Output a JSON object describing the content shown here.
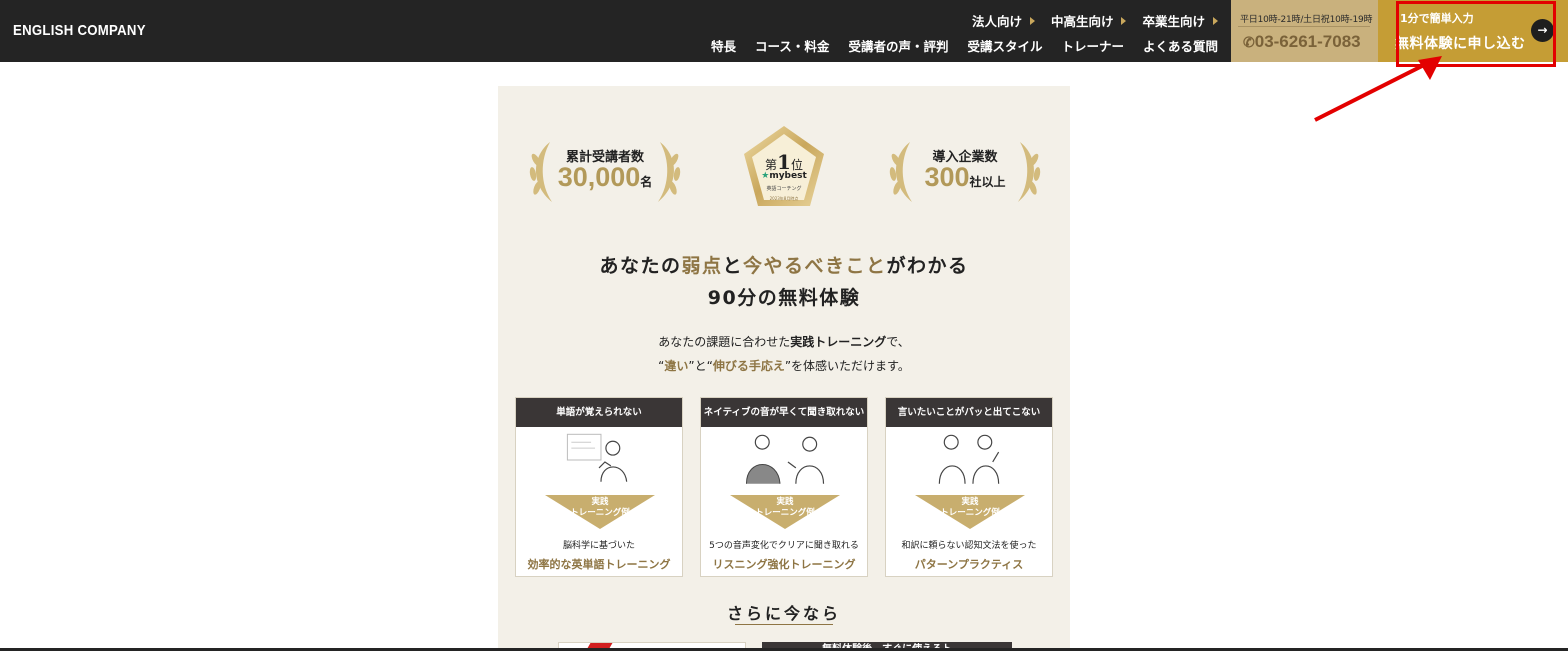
{
  "header": {
    "logo": "ENGLISH COMPANY",
    "sub_nav": [
      "法人向け",
      "中高生向け",
      "卒業生向け"
    ],
    "main_nav": [
      "特長",
      "コース・料金",
      "受講者の声・評判",
      "受講スタイル",
      "トレーナー",
      "よくある質問"
    ],
    "phone": {
      "hours": "平日10時-21時/土日祝10時-19時",
      "number": "03-6261-7083"
    },
    "cta": {
      "small": "1分で簡単入力",
      "main": "無料体験に申し込む",
      "arrow": "→"
    }
  },
  "stats": [
    {
      "label": "累計受講者数",
      "value": "30,000",
      "unit": "名"
    },
    {
      "label": "導入企業数",
      "value": "300",
      "unit": "社以上"
    }
  ],
  "medal": {
    "rank_prefix": "第",
    "rank_num": "1",
    "rank_suffix": "位",
    "brand": "mybest",
    "category": "英語コーチング",
    "footnote": "2023年8月時点"
  },
  "headline": {
    "line1_a": "あなたの",
    "line1_b": "弱点",
    "line1_c": "と",
    "line1_d": "今やるべきこと",
    "line1_e": "がわかる",
    "line2": "90分の無料体験"
  },
  "lead": {
    "line1_a": "あなたの課題に合わせた",
    "line1_b": "実践トレーニング",
    "line1_c": "で、",
    "line2_a": "“",
    "line2_b": "違い",
    "line2_c": "”と“",
    "line2_d": "伸びる手応え",
    "line2_e": "”を体感いただけます。"
  },
  "cards": [
    {
      "head": "単語が覚えられない",
      "badge_1": "実践",
      "badge_2": "トレーニング例",
      "desc": "脳科学に基づいた",
      "title": "効率的な英単語トレーニング"
    },
    {
      "head": "ネイティブの音が早くて聞き取れない",
      "badge_1": "実践",
      "badge_2": "トレーニング例",
      "desc": "5つの音声変化でクリアに聞き取れる",
      "title": "リスニング強化トレーニング"
    },
    {
      "head": "言いたいことがパッと出てこない",
      "badge_1": "実践",
      "badge_2": "トレーニング例",
      "desc": "和訳に頼らない認知文法を使った",
      "title": "パターンプラクティス"
    }
  ],
  "more": {
    "title": "さらに今なら",
    "button_b": "無料体験後、すぐに使えるト"
  },
  "colors": {
    "header_bg": "#242424",
    "gold": "#c59d35",
    "text_gold": "#8e7544",
    "panel_bg": "#f3f0e8",
    "highlight": "#e30000"
  }
}
